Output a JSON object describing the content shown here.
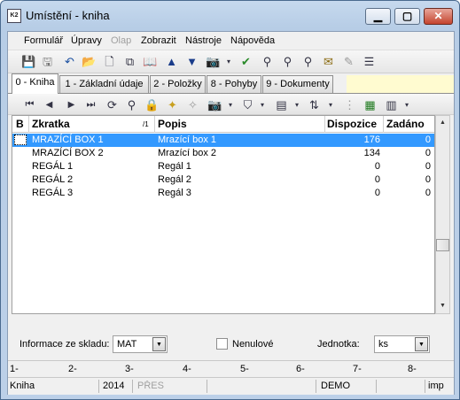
{
  "window": {
    "title": "Umístění - kniha",
    "app_icon_label": "K2",
    "minimize_glyph": "▁",
    "maximize_glyph": "▢",
    "close_glyph": "✕"
  },
  "menu": {
    "items": [
      {
        "label": "Formulář",
        "enabled": true
      },
      {
        "label": "Úpravy",
        "enabled": true
      },
      {
        "label": "Olap",
        "enabled": false
      },
      {
        "label": "Zobrazit",
        "enabled": true
      },
      {
        "label": "Nástroje",
        "enabled": true
      },
      {
        "label": "Nápověda",
        "enabled": true
      }
    ]
  },
  "toolbar1": {
    "icons": [
      "save-icon",
      "save-as-icon",
      "undo-icon",
      "open-folder-icon",
      "new-document-icon",
      "copy-document-icon",
      "book-icon",
      "arrow-up-icon",
      "arrow-down-icon",
      "camera-icon",
      "dropdown-arrow-icon",
      "run-icon",
      "binoculars-icon",
      "find-next-icon",
      "find-all-icon",
      "mail-icon",
      "edit-disabled-icon",
      "list-menu-icon"
    ],
    "glyphs": [
      "💾",
      "🖫",
      "↶",
      "📂",
      "🗋",
      "⧉",
      "📖",
      "▲",
      "▼",
      "📷",
      "▾",
      "✔",
      "⚲",
      "⚲",
      "⚲",
      "✉",
      "✎",
      "☰"
    ]
  },
  "tabs": [
    {
      "label": "0 - Kniha",
      "active": true
    },
    {
      "label": "1 - Základní údaje",
      "active": false
    },
    {
      "label": "2 - Položky",
      "active": false
    },
    {
      "label": "8 - Pohyby",
      "active": false
    },
    {
      "label": "9 - Dokumenty",
      "active": false
    }
  ],
  "toolbar2": {
    "icons": [
      "first-record-icon",
      "prev-record-icon",
      "next-record-icon",
      "last-record-icon",
      "refresh-icon",
      "binoculars-icon",
      "lock-icon",
      "add-star-icon",
      "remove-star-icon",
      "camera-icon",
      "dropdown-arrow-icon",
      "filter-icon",
      "dropdown-arrow-icon",
      "columns-icon",
      "dropdown-arrow-icon",
      "sort-icon",
      "dropdown-arrow-icon",
      "tree-icon",
      "excel-icon",
      "report-icon",
      "dropdown-arrow-icon"
    ],
    "glyphs": [
      "⏮",
      "◀",
      "▶",
      "⏭",
      "⟳",
      "⚲",
      "🔒",
      "✦",
      "✧",
      "📷",
      "▾",
      "⛉",
      "▾",
      "▤",
      "▾",
      "⇅",
      "▾",
      "⋮",
      "▦",
      "▥",
      "▾"
    ]
  },
  "grid": {
    "columns": [
      "B",
      "Zkratka",
      "/1",
      "Popis",
      "Dispozice",
      "Zadáno"
    ],
    "rows": [
      {
        "zkratka": "MRAZÍCÍ BOX 1",
        "popis": "Mrazící box 1",
        "dispozice": "176",
        "zadano": "0",
        "selected": true
      },
      {
        "zkratka": "MRAZÍCÍ BOX 2",
        "popis": "Mrazící box 2",
        "dispozice": "134",
        "zadano": "0",
        "selected": false
      },
      {
        "zkratka": "REGÁL 1",
        "popis": "Regál 1",
        "dispozice": "0",
        "zadano": "0",
        "selected": false
      },
      {
        "zkratka": "REGÁL 2",
        "popis": "Regál 2",
        "dispozice": "0",
        "zadano": "0",
        "selected": false
      },
      {
        "zkratka": "REGÁL 3",
        "popis": "Regál 3",
        "dispozice": "0",
        "zadano": "0",
        "selected": false
      }
    ],
    "scroll_up_glyph": "▲",
    "scroll_down_glyph": "▼"
  },
  "bottom_panel": {
    "sklad_label": "Informace ze skladu:",
    "sklad_value": "MAT",
    "nenulove_label": "Nenulové",
    "nenulove_checked": false,
    "jednotka_label": "Jednotka:",
    "jednotka_value": "ks",
    "combo_glyph": "▼"
  },
  "ruler": {
    "marks": [
      "1-",
      "2-",
      "3-",
      "4-",
      "5-",
      "6-",
      "7-",
      "8-"
    ]
  },
  "statusbar": {
    "fields": [
      {
        "text": "Kniha",
        "enabled": true
      },
      {
        "text": "2014",
        "enabled": true
      },
      {
        "text": "PŘES",
        "enabled": false
      },
      {
        "text": "",
        "enabled": true
      },
      {
        "text": "DEMO",
        "enabled": true
      },
      {
        "text": "",
        "enabled": true
      },
      {
        "text": "imp",
        "enabled": true
      }
    ]
  }
}
